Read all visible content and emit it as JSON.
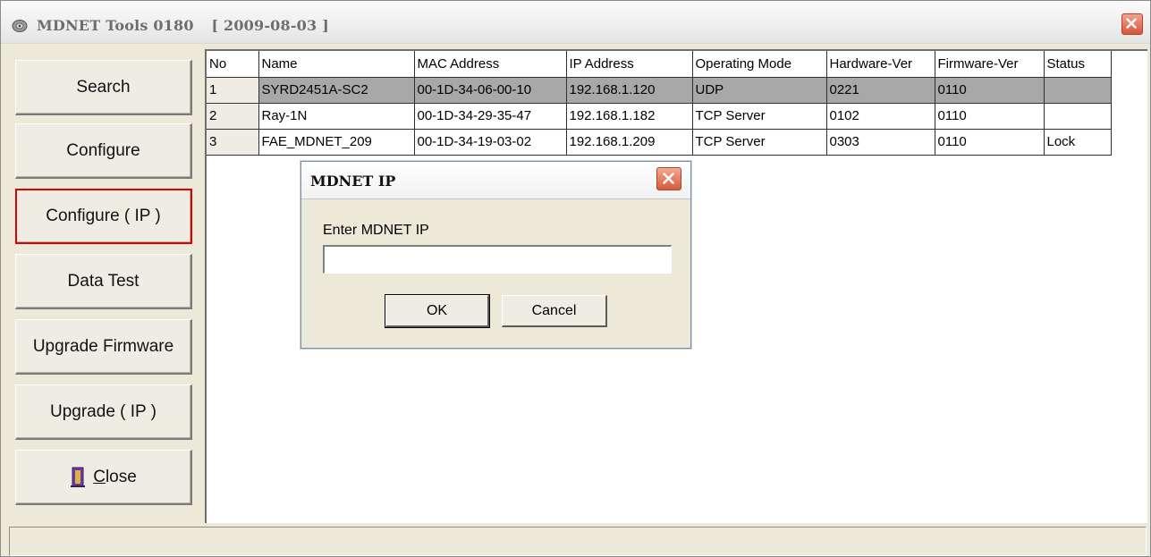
{
  "window": {
    "title": "MDNET Tools 0180",
    "date": "[ 2009-08-03 ]"
  },
  "sidebar": {
    "buttons": [
      {
        "label": "Search"
      },
      {
        "label": "Configure"
      },
      {
        "label": "Configure ( IP )"
      },
      {
        "label": "Data Test"
      },
      {
        "label": "Upgrade Firmware"
      },
      {
        "label": "Upgrade ( IP )"
      },
      {
        "label": "Close",
        "mnemonic": "C",
        "rest": "lose"
      }
    ],
    "selected": "Configure ( IP )"
  },
  "grid": {
    "columns": [
      "No",
      "Name",
      "MAC Address",
      "IP Address",
      "Operating Mode",
      "Hardware-Ver",
      "Firmware-Ver",
      "Status"
    ],
    "rows": [
      [
        "1",
        "SYRD2451A-SC2",
        "00-1D-34-06-00-10",
        "192.168.1.120",
        "UDP",
        "0221",
        "0110",
        ""
      ],
      [
        "2",
        "Ray-1N",
        "00-1D-34-29-35-47",
        "192.168.1.182",
        "TCP Server",
        "0102",
        "0110",
        ""
      ],
      [
        "3",
        "FAE_MDNET_209",
        "00-1D-34-19-03-02",
        "192.168.1.209",
        "TCP Server",
        "0303",
        "0110",
        "Lock"
      ]
    ]
  },
  "dialog": {
    "title": "MDNET IP",
    "label": "Enter MDNET IP",
    "input_value": "",
    "ok_label": "OK",
    "cancel_label": "Cancel"
  },
  "colors": {
    "selection": "#a8a8a8",
    "highlight_border": "#e00000",
    "close_button": "#d7553a"
  }
}
